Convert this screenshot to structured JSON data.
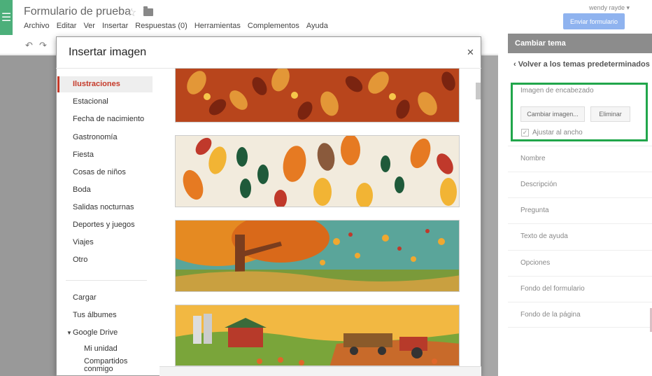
{
  "app": {
    "doc_title": "Formulario de prueba",
    "menu": [
      "Archivo",
      "Editar",
      "Ver",
      "Insertar",
      "Respuestas (0)",
      "Herramientas",
      "Complementos",
      "Ayuda"
    ]
  },
  "user": {
    "name": "wendy rayde ▾"
  },
  "submit_button": "Enviar formulario",
  "theme_panel": {
    "title": "Cambiar tema",
    "back_link": "‹  Volver a los temas predeterminados",
    "header_image": {
      "label": "Imagen de encabezado",
      "change_button": "Cambiar imagen...",
      "delete_button": "Eliminar",
      "fit_checkbox": "Ajustar al ancho",
      "fit_checked": true
    },
    "sections": [
      "Nombre",
      "Descripción",
      "Pregunta",
      "Texto de ayuda",
      "Opciones",
      "Fondo del formulario",
      "Fondo de la página"
    ]
  },
  "dialog": {
    "title": "Insertar imagen",
    "categories": [
      "Ilustraciones",
      "Estacional",
      "Fecha de nacimiento",
      "Gastronomía",
      "Fiesta",
      "Cosas de niños",
      "Boda",
      "Salidas nocturnas",
      "Deportes y juegos",
      "Viajes",
      "Otro"
    ],
    "selected_category": 0,
    "sources": [
      "Cargar",
      "Tus álbumes",
      "Google Drive"
    ],
    "drive_items": [
      "Mi unidad",
      "Compartidos conmigo"
    ]
  },
  "icons": {
    "menu": "menu-icon",
    "star": "star-icon",
    "folder": "folder-icon",
    "undo": "undo-icon",
    "redo": "redo-icon",
    "close": "close-icon"
  },
  "colors": {
    "accent_red": "#c53929",
    "highlight_green": "#21a64b",
    "submit_blue": "#8fb3ef",
    "panel_header": "#8c8c8c"
  }
}
